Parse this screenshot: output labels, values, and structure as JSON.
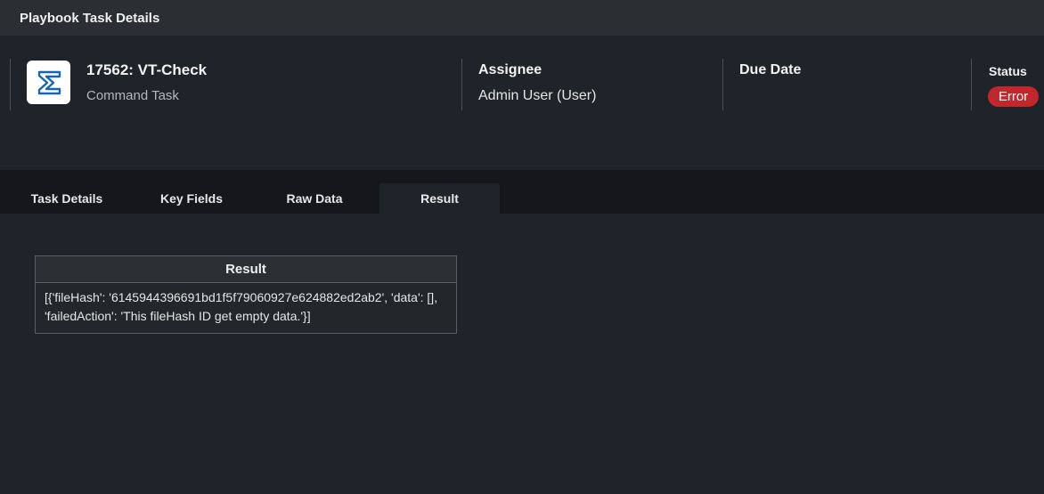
{
  "window": {
    "title": "Playbook Task Details"
  },
  "task": {
    "title": "17562: VT-Check",
    "type": "Command Task",
    "assignee_label": "Assignee",
    "assignee": "Admin User (User)",
    "due_date_label": "Due Date",
    "due_date": "",
    "status_label": "Status",
    "status": "Error",
    "status_color": "#c1272d",
    "icon": "sigma-icon",
    "icon_color": "#1565c0"
  },
  "tabs": [
    {
      "label": "Task Details",
      "active": false
    },
    {
      "label": "Key Fields",
      "active": false
    },
    {
      "label": "Raw Data",
      "active": false
    },
    {
      "label": "Result",
      "active": true
    }
  ],
  "result_table": {
    "header": "Result",
    "value": "[{'fileHash': '6145944396691bd1f5f79060927e624882ed2ab2', 'data': [], 'failedAction': 'This fileHash ID get empty data.'}]"
  }
}
